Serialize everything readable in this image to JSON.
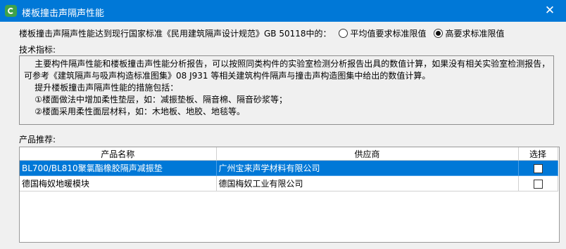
{
  "window": {
    "title": "楼板撞击声隔声性能",
    "close_icon": "close-icon"
  },
  "standard": {
    "prompt": "楼板撞击声隔声性能达到现行国家标准《民用建筑隔声设计规范》GB 50118中的：",
    "options": [
      {
        "label": "平均值要求标准限值",
        "selected": false
      },
      {
        "label": "高要求标准限值",
        "selected": true
      }
    ]
  },
  "tech": {
    "label": "技术指标:",
    "lines": [
      "    主要构件隔声性能和楼板撞击声性能分析报告，可以按照同类构件的实验室检测分析报告出具的数值计算，如果没有相关实验室检测报告，",
      "可参考《建筑隔声与吸声构造标准图集》08 J931 等相关建筑构件隔声与撞击声构造图集中给出的数值计算。",
      "    提升楼板撞击声隔声性能的措施包括：",
      "    ①楼面做法中增加柔性垫层，如：减振垫板、隔音棉、隔音砂浆等；",
      "    ②楼面采用柔性面层材料，如：木地板、地胶、地毯等。"
    ]
  },
  "products": {
    "label": "产品推荐:",
    "columns": [
      "产品名称",
      "供应商",
      "选择"
    ],
    "rows": [
      {
        "name": "BL700/BL810聚氯酯橡胶隔声减振垫",
        "supplier": "广州宝来声学材料有限公司",
        "checked": false,
        "selected": true
      },
      {
        "name": "德国梅奴地暖模块",
        "supplier": "德国梅奴工业有限公司",
        "checked": false,
        "selected": false
      }
    ]
  }
}
